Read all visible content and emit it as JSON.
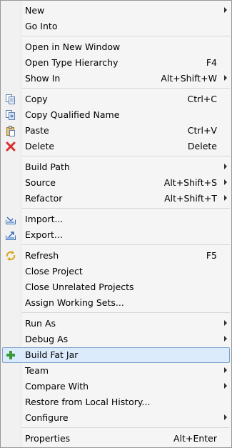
{
  "menu": {
    "new": {
      "label": "New"
    },
    "go_into": {
      "label": "Go Into"
    },
    "open_new_window": {
      "label": "Open in New Window"
    },
    "open_type_hierarchy": {
      "label": "Open Type Hierarchy",
      "accel": "F4"
    },
    "show_in": {
      "label": "Show In",
      "accel": "Alt+Shift+W"
    },
    "copy": {
      "label": "Copy",
      "accel": "Ctrl+C",
      "icon": "copy-icon"
    },
    "copy_qualified": {
      "label": "Copy Qualified Name",
      "icon": "copy-qualified-icon"
    },
    "paste": {
      "label": "Paste",
      "accel": "Ctrl+V",
      "icon": "paste-icon"
    },
    "delete": {
      "label": "Delete",
      "accel": "Delete",
      "icon": "delete-icon"
    },
    "build_path": {
      "label": "Build Path"
    },
    "source": {
      "label": "Source",
      "accel": "Alt+Shift+S"
    },
    "refactor": {
      "label": "Refactor",
      "accel": "Alt+Shift+T"
    },
    "import": {
      "label": "Import...",
      "icon": "import-icon"
    },
    "export": {
      "label": "Export...",
      "icon": "export-icon"
    },
    "refresh": {
      "label": "Refresh",
      "accel": "F5",
      "icon": "refresh-icon"
    },
    "close_project": {
      "label": "Close Project"
    },
    "close_unrelated": {
      "label": "Close Unrelated Projects"
    },
    "assign_working_sets": {
      "label": "Assign Working Sets..."
    },
    "run_as": {
      "label": "Run As"
    },
    "debug_as": {
      "label": "Debug As"
    },
    "build_fat_jar": {
      "label": "Build Fat Jar",
      "icon": "add-icon"
    },
    "team": {
      "label": "Team"
    },
    "compare_with": {
      "label": "Compare With"
    },
    "restore_history": {
      "label": "Restore from Local History..."
    },
    "configure": {
      "label": "Configure"
    },
    "properties": {
      "label": "Properties",
      "accel": "Alt+Enter"
    }
  },
  "colors": {
    "highlight_bg": "#dcebfc",
    "highlight_border": "#7da2ce",
    "delete_red": "#d93030",
    "add_green": "#3a9a3a"
  }
}
